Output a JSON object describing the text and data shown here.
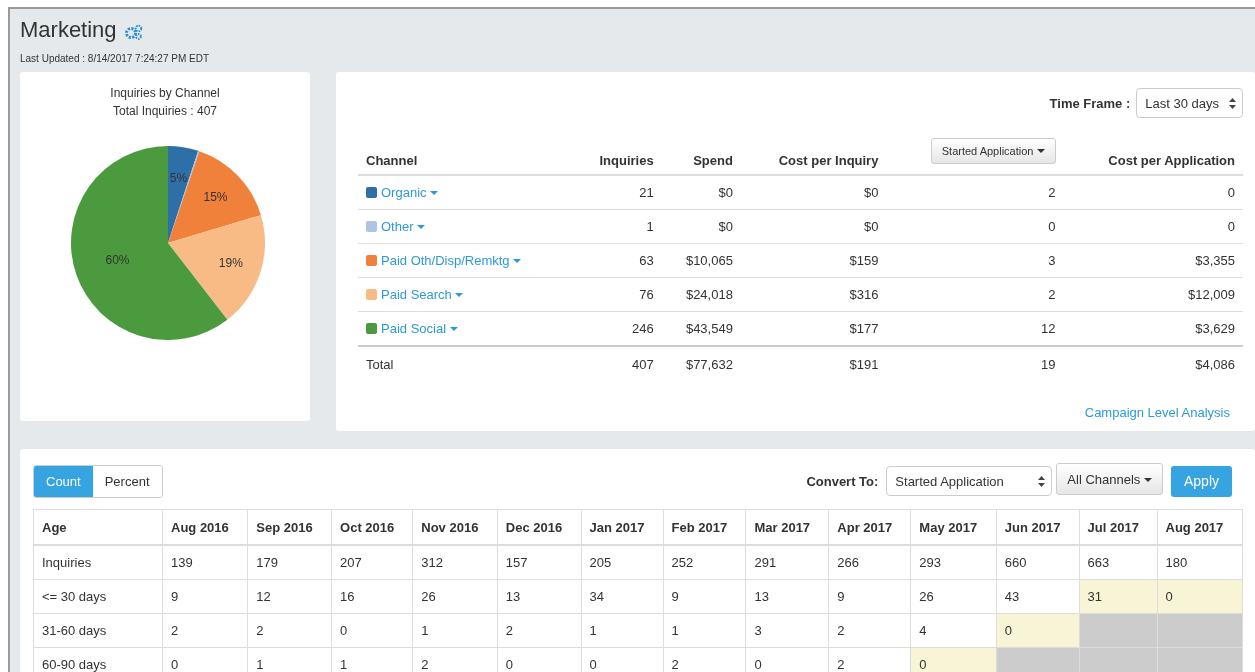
{
  "page": {
    "title": "Marketing",
    "last_updated": "Last Updated : 8/14/2017 7:24:27 PM EDT"
  },
  "pie_card": {
    "subtitle": "Total Inquiries : 407",
    "chart_data": {
      "type": "pie",
      "title": "Inquiries by Channel",
      "values": [
        5,
        0.2,
        15,
        19,
        60
      ],
      "value_labels": [
        "5%",
        null,
        "15%",
        "19%",
        "60%"
      ]
    }
  },
  "time_frame": {
    "label": "Time Frame :",
    "value": "Last 30 days"
  },
  "channel_table": {
    "columns": [
      "Channel",
      "Inquiries",
      "Spend",
      "Cost per Inquiry",
      "Started Application",
      "Cost per Application"
    ],
    "rows": [
      {
        "color": "#2f6fa8",
        "cells": [
          "Organic",
          "21",
          "$0",
          "$0",
          "2",
          "0"
        ]
      },
      {
        "color": "#aec4e2",
        "cells": [
          "Other",
          "1",
          "$0",
          "$0",
          "0",
          "0"
        ]
      },
      {
        "color": "#f0813a",
        "cells": [
          "Paid Oth/Disp/Remktg",
          "63",
          "$10,065",
          "$159",
          "3",
          "$3,355"
        ]
      },
      {
        "color": "#f9bb86",
        "cells": [
          "Paid Search",
          "76",
          "$24,018",
          "$316",
          "2",
          "$12,009"
        ]
      },
      {
        "color": "#4b9a3e",
        "cells": [
          "Paid Social",
          "246",
          "$43,549",
          "$177",
          "12",
          "$3,629"
        ]
      }
    ],
    "total": [
      "Total",
      "407",
      "$77,632",
      "$191",
      "19",
      "$4,086"
    ],
    "link": "Campaign Level Analysis"
  },
  "view_toggle": [
    {
      "label": "Count",
      "selected": true
    },
    {
      "label": "Percent",
      "selected": false
    }
  ],
  "convert": {
    "label": "Convert To:",
    "value": "Started Application",
    "channels": "All Channels",
    "apply": "Apply"
  },
  "cohort_table": {
    "columns": [
      "Age",
      "Aug 2016",
      "Sep 2016",
      "Oct 2016",
      "Nov 2016",
      "Dec 2016",
      "Jan 2017",
      "Feb 2017",
      "Mar 2017",
      "Apr 2017",
      "May 2017",
      "Jun 2017",
      "Jul 2017",
      "Aug 2017"
    ],
    "rows": [
      {
        "cells": [
          {
            "kind": "label",
            "text": "Inquiries"
          },
          {
            "kind": "value",
            "text": "139"
          },
          {
            "kind": "value",
            "text": "179"
          },
          {
            "kind": "value",
            "text": "207"
          },
          {
            "kind": "value",
            "text": "312"
          },
          {
            "kind": "value",
            "text": "157"
          },
          {
            "kind": "value",
            "text": "205"
          },
          {
            "kind": "value",
            "text": "252"
          },
          {
            "kind": "value",
            "text": "291"
          },
          {
            "kind": "value",
            "text": "266"
          },
          {
            "kind": "value",
            "text": "293"
          },
          {
            "kind": "value",
            "text": "660"
          },
          {
            "kind": "value",
            "text": "663"
          },
          {
            "kind": "value",
            "text": "180"
          }
        ]
      },
      {
        "cells": [
          {
            "kind": "label",
            "text": "<= 30 days"
          },
          {
            "kind": "value",
            "text": "9"
          },
          {
            "kind": "value",
            "text": "12"
          },
          {
            "kind": "value",
            "text": "16"
          },
          {
            "kind": "value",
            "text": "26"
          },
          {
            "kind": "value",
            "text": "13"
          },
          {
            "kind": "value",
            "text": "34"
          },
          {
            "kind": "value",
            "text": "9"
          },
          {
            "kind": "value",
            "text": "13"
          },
          {
            "kind": "value",
            "text": "9"
          },
          {
            "kind": "value",
            "text": "26"
          },
          {
            "kind": "value",
            "text": "43"
          },
          {
            "kind": "partial",
            "text": "31"
          },
          {
            "kind": "partial",
            "text": "0"
          }
        ]
      },
      {
        "cells": [
          {
            "kind": "label",
            "text": "31-60 days"
          },
          {
            "kind": "value",
            "text": "2"
          },
          {
            "kind": "value",
            "text": "2"
          },
          {
            "kind": "value",
            "text": "0"
          },
          {
            "kind": "value",
            "text": "1"
          },
          {
            "kind": "value",
            "text": "2"
          },
          {
            "kind": "value",
            "text": "1"
          },
          {
            "kind": "value",
            "text": "1"
          },
          {
            "kind": "value",
            "text": "3"
          },
          {
            "kind": "value",
            "text": "2"
          },
          {
            "kind": "value",
            "text": "4"
          },
          {
            "kind": "partial",
            "text": "0"
          },
          {
            "kind": "blank"
          },
          {
            "kind": "blank"
          }
        ]
      },
      {
        "cells": [
          {
            "kind": "label",
            "text": "60-90 days"
          },
          {
            "kind": "value",
            "text": "0"
          },
          {
            "kind": "value",
            "text": "1"
          },
          {
            "kind": "value",
            "text": "1"
          },
          {
            "kind": "value",
            "text": "2"
          },
          {
            "kind": "value",
            "text": "0"
          },
          {
            "kind": "value",
            "text": "0"
          },
          {
            "kind": "value",
            "text": "2"
          },
          {
            "kind": "value",
            "text": "0"
          },
          {
            "kind": "value",
            "text": "2"
          },
          {
            "kind": "partial",
            "text": "0"
          },
          {
            "kind": "blank"
          },
          {
            "kind": "blank"
          },
          {
            "kind": "blank"
          }
        ]
      }
    ]
  }
}
